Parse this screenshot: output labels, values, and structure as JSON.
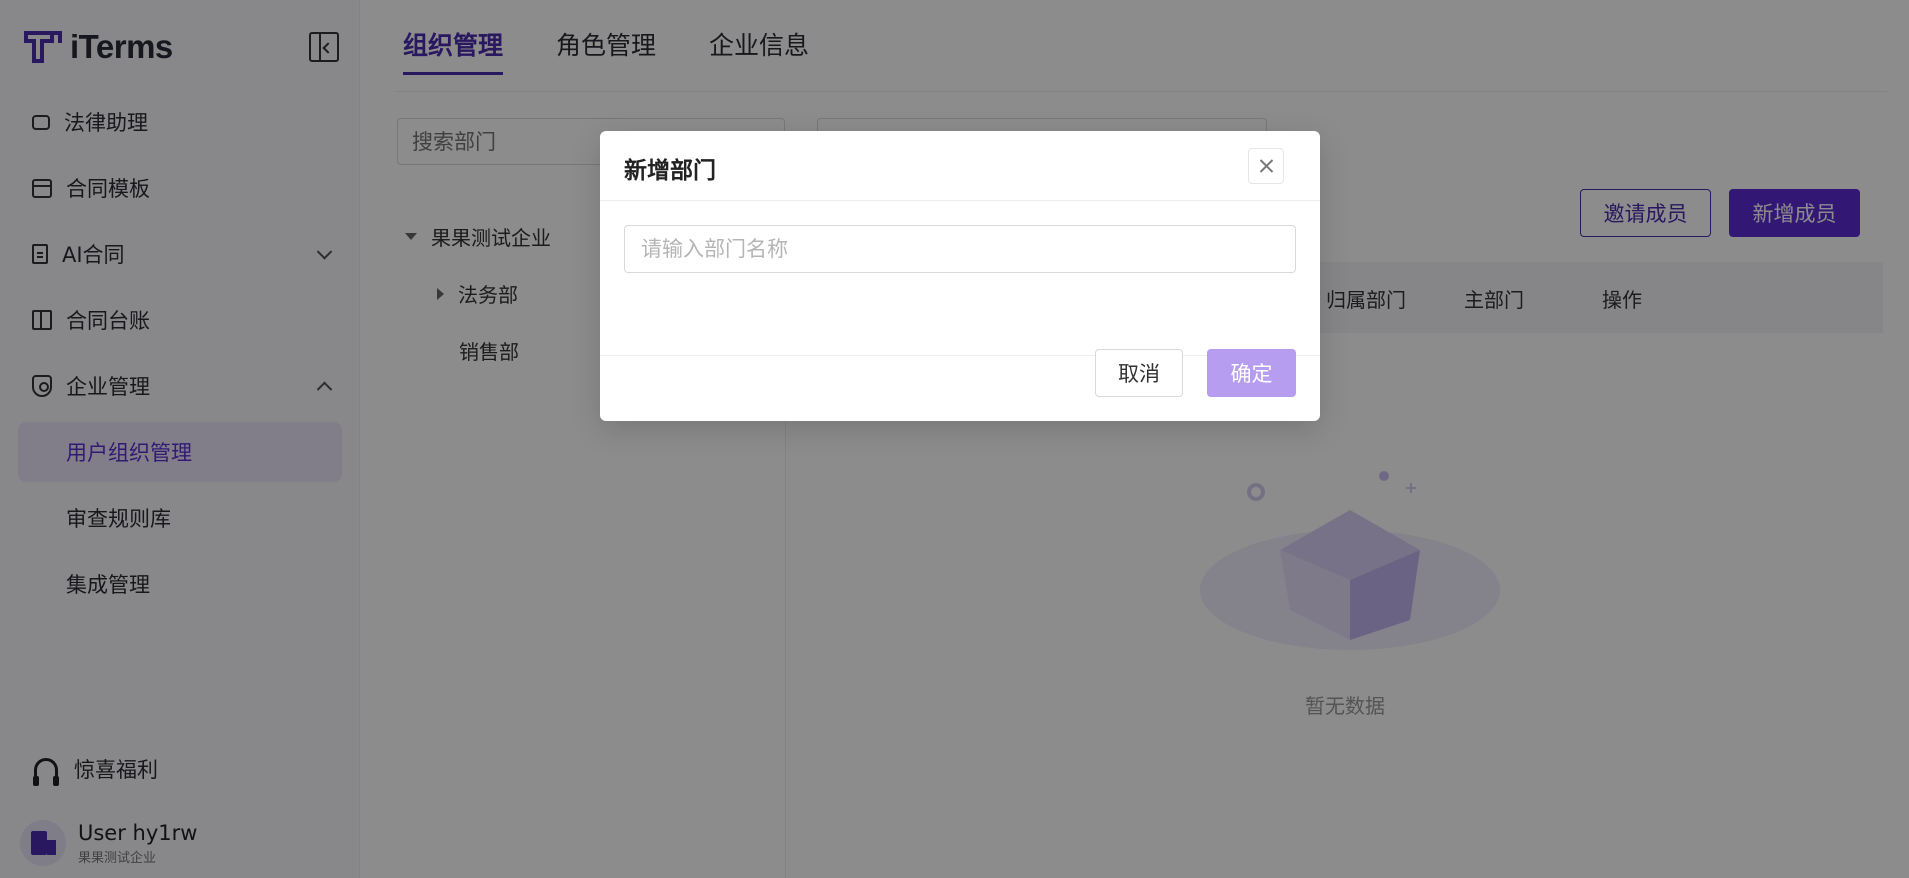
{
  "app": {
    "name": "iTerms"
  },
  "sidebar": {
    "items": [
      {
        "label": "法律助理",
        "icon": "chat-icon"
      },
      {
        "label": "合同模板",
        "icon": "archive-icon"
      },
      {
        "label": "AI合同",
        "icon": "document-icon",
        "expanded": false
      },
      {
        "label": "合同台账",
        "icon": "ledger-icon"
      },
      {
        "label": "企业管理",
        "icon": "shield-icon",
        "expanded": true
      }
    ],
    "sub_items": [
      {
        "label": "用户组织管理",
        "active": true
      },
      {
        "label": "审查规则库",
        "active": false
      },
      {
        "label": "集成管理",
        "active": false
      }
    ],
    "gift_label": "惊喜福利",
    "user": {
      "name": "User hy1rw",
      "org": "果果测试企业"
    }
  },
  "tabs": [
    {
      "label": "组织管理",
      "active": true
    },
    {
      "label": "角色管理",
      "active": false
    },
    {
      "label": "企业信息",
      "active": false
    }
  ],
  "dept_search": {
    "placeholder": "搜索部门"
  },
  "tree": {
    "root": "果果测试企业",
    "children": [
      "法务部",
      "销售部"
    ]
  },
  "members": {
    "invite_label": "邀请成员",
    "add_label": "新增成员",
    "columns": [
      "归属部门",
      "主部门",
      "操作"
    ],
    "empty_text": "暂无数据"
  },
  "modal": {
    "title": "新增部门",
    "input_placeholder": "请输入部门名称",
    "input_value": "",
    "cancel_label": "取消",
    "ok_label": "确定"
  },
  "colors": {
    "primary": "#5b2bd6",
    "primary_disabled": "#b69df0",
    "active_bg": "#ece6fb"
  }
}
